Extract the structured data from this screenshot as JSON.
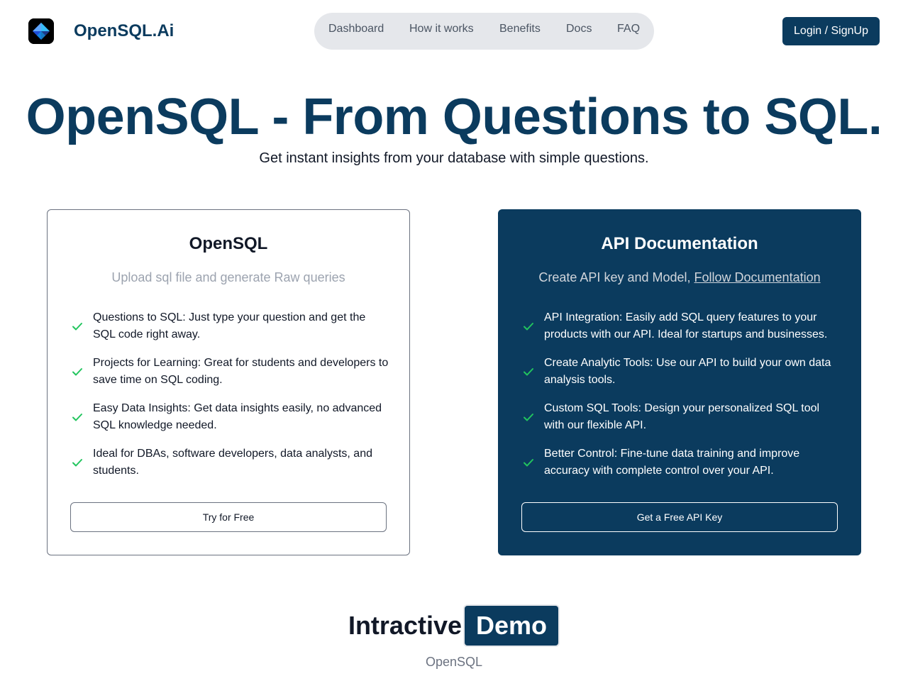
{
  "header": {
    "brand": "OpenSQL.Ai",
    "nav": [
      "Dashboard",
      "How it works",
      "Benefits",
      "Docs",
      "FAQ"
    ],
    "login_label": "Login / SignUp"
  },
  "hero": {
    "title": "OpenSQL - From Questions to SQL.",
    "subtitle": "Get instant insights from your database with simple questions."
  },
  "cards": {
    "left": {
      "title": "OpenSQL",
      "description": "Upload sql file and generate Raw queries",
      "features": [
        "Questions to SQL: Just type your question and get the SQL code right away.",
        "Projects for Learning: Great for students and developers to save time on SQL coding.",
        "Easy Data Insights: Get data insights easily, no advanced SQL knowledge needed.",
        "Ideal for DBAs, software developers, data analysts, and students."
      ],
      "button_label": "Try for Free"
    },
    "right": {
      "title": "API Documentation",
      "description_prefix": "Create API key and Model, ",
      "description_link": "Follow Documentation",
      "features": [
        "API Integration: Easily add SQL query features to your products with our API. Ideal for startups and businesses.",
        "Create Analytic Tools: Use our API to build your own data analysis tools.",
        "Custom SQL Tools: Design your personalized SQL tool with our flexible API.",
        "Better Control: Fine-tune data training and improve accuracy with complete control over your API."
      ],
      "button_label": "Get a Free API Key"
    }
  },
  "demo": {
    "heading_word": "Intractive",
    "heading_badge": "Demo",
    "subtitle": "OpenSQL"
  },
  "icons": {
    "logo": "diamond-logo-icon",
    "check": "check-icon"
  },
  "colors": {
    "brand": "#0b3b5e",
    "check": "#22c55e",
    "nav_bg": "#e5e7eb"
  }
}
